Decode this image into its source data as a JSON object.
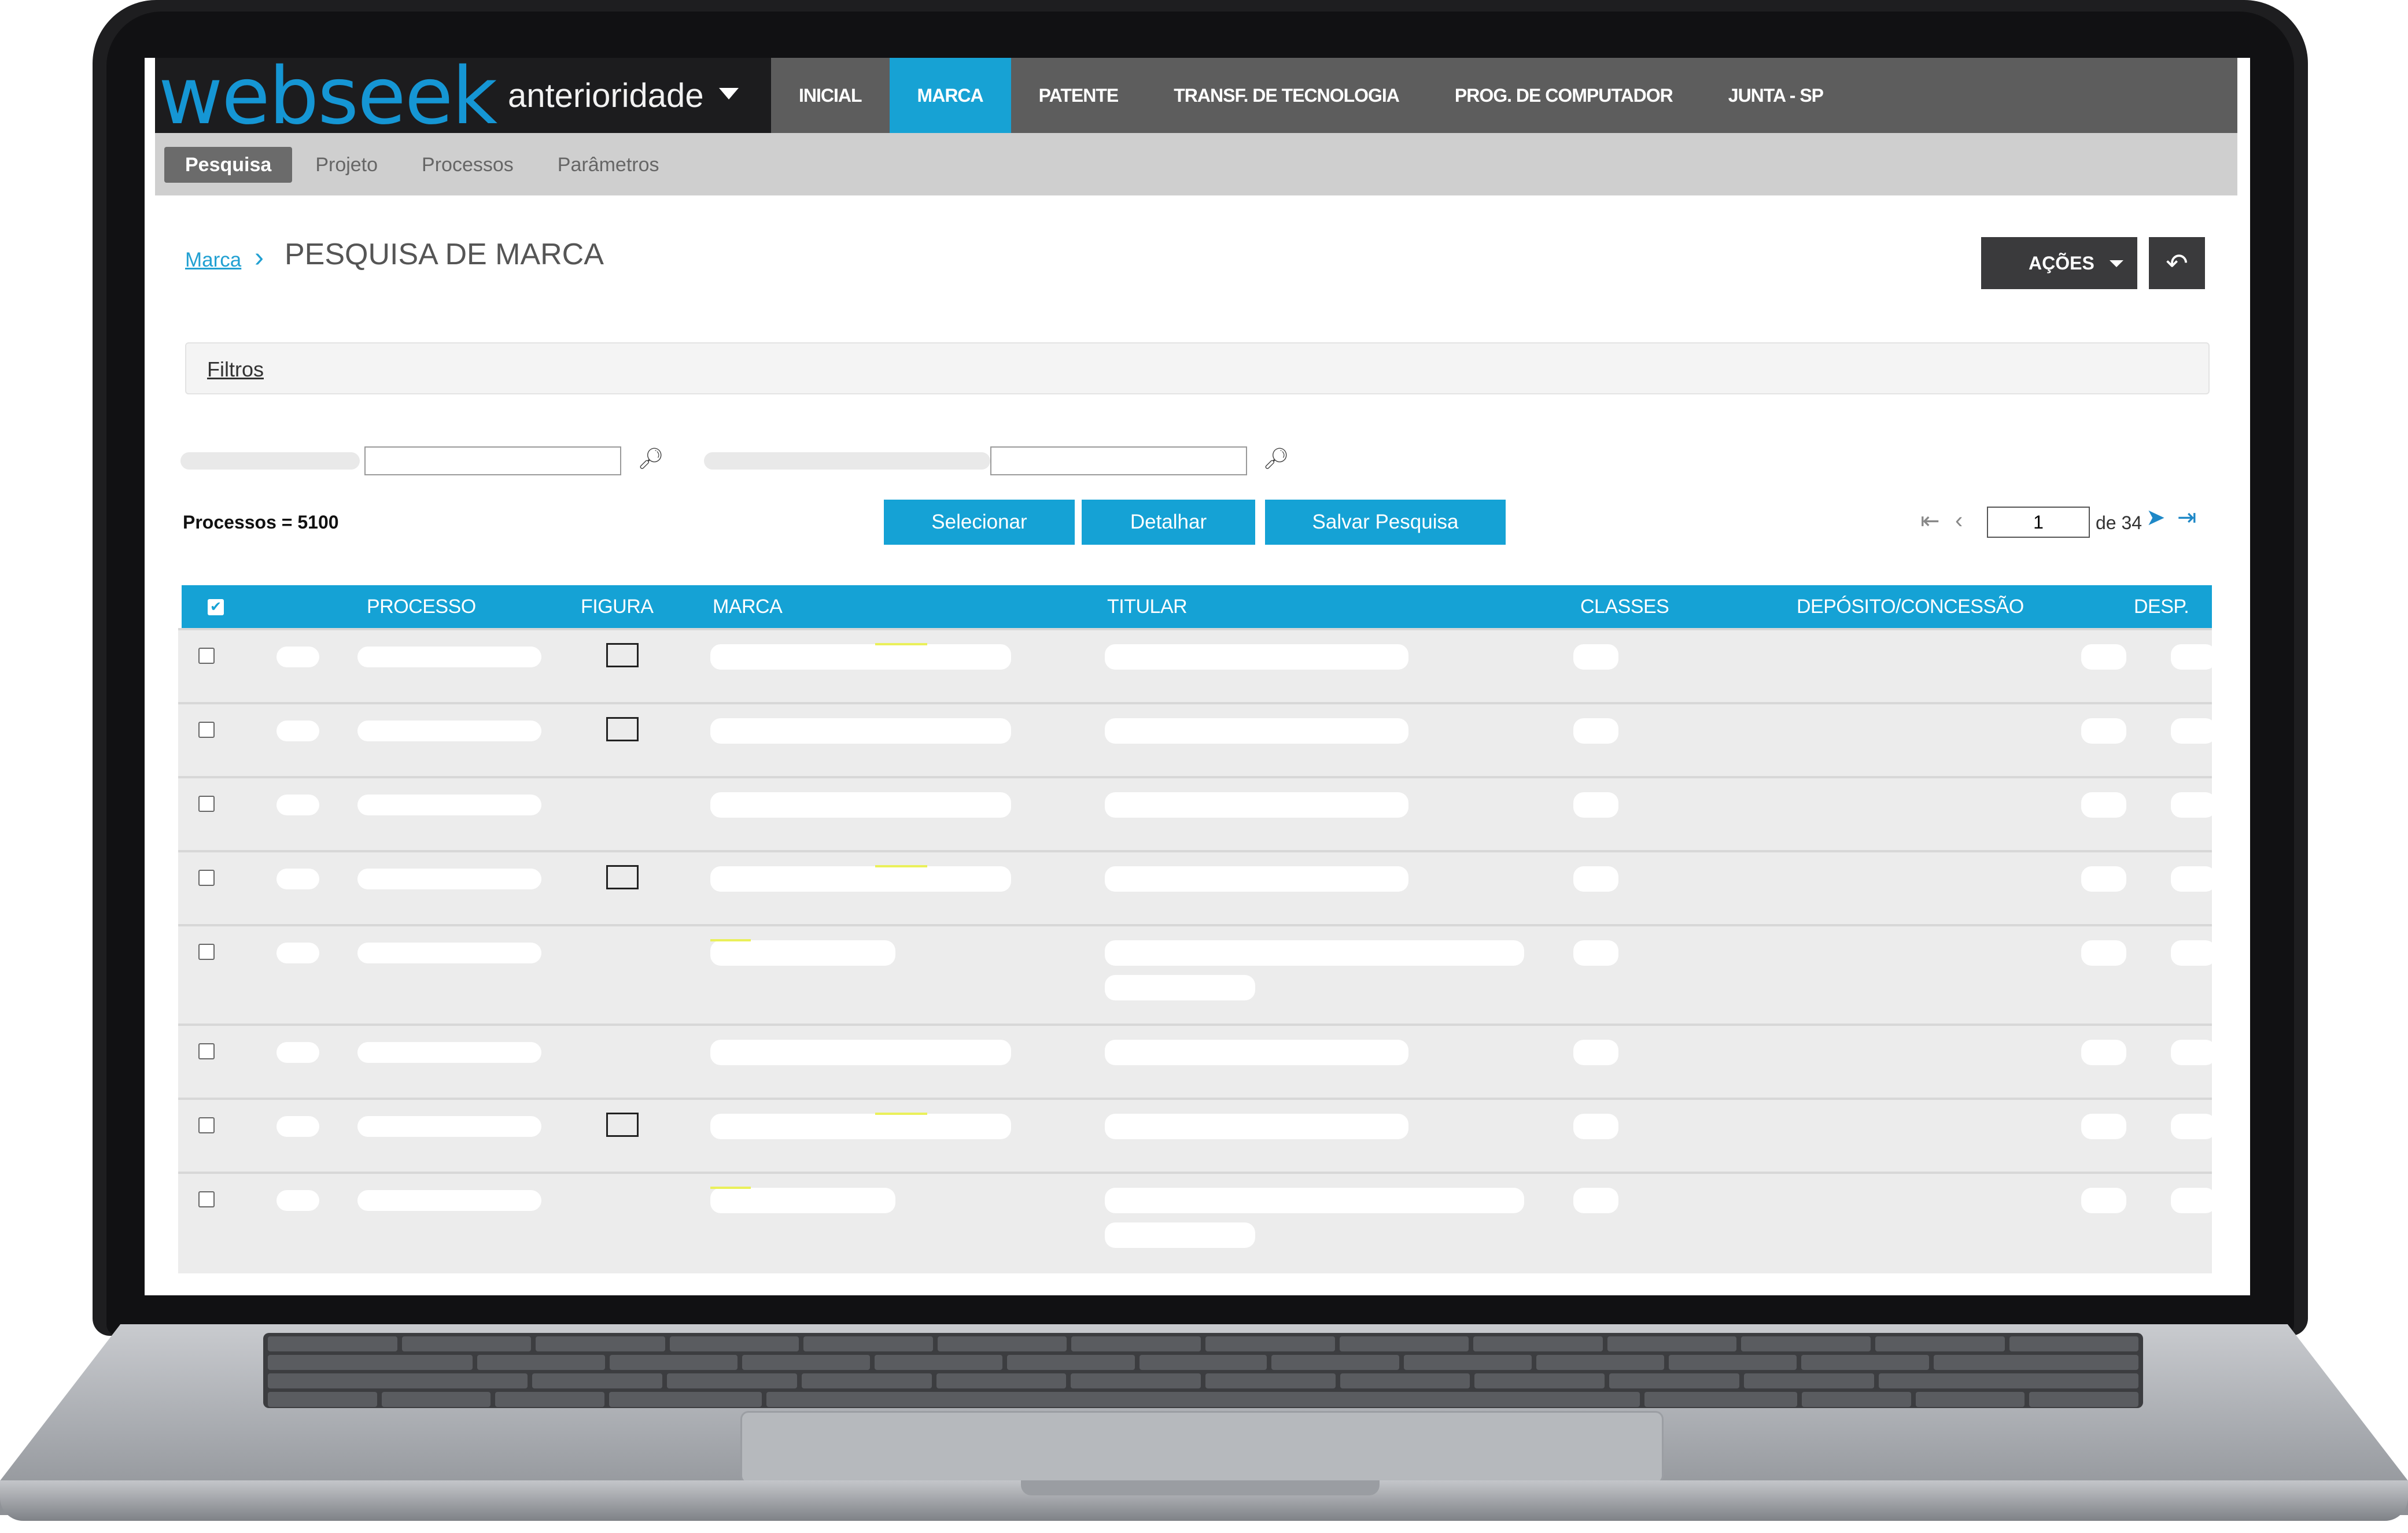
{
  "app": {
    "logo_main": "webseek",
    "logo_sub": "anterioridade",
    "nav": [
      "INICIAL",
      "MARCA",
      "PATENTE",
      "TRANSF. DE TECNOLOGIA",
      "PROG. DE COMPUTADOR",
      "JUNTA - SP"
    ],
    "active_nav": "MARCA",
    "subtabs": [
      "Pesquisa",
      "Projeto",
      "Processos",
      "Parâmetros"
    ],
    "active_subtab": "Pesquisa"
  },
  "breadcrumb": {
    "link": "Marca",
    "separator": "›",
    "title": "PESQUISA DE MARCA"
  },
  "actions": {
    "acoes_label": "AÇÕES",
    "back_icon": "back-arrow-icon"
  },
  "filters": {
    "label": "Filtros"
  },
  "results": {
    "count_label": "Processos = 5100"
  },
  "buttons": {
    "selecionar": "Selecionar",
    "detalhar": "Detalhar",
    "salvar": "Salvar Pesquisa"
  },
  "pager": {
    "current_page": "1",
    "of_label": "de 34"
  },
  "table": {
    "columns": [
      "PROCESSO",
      "FIGURA",
      "MARCA",
      "TITULAR",
      "CLASSES",
      "DEPÓSITO/CONCESSÃO",
      "DESP."
    ],
    "row_count": 8,
    "rows_with_figure": [
      1,
      2,
      4,
      7
    ]
  },
  "colors": {
    "accent": "#15a2d5",
    "dark": "#1c1c1e",
    "nav_bg": "#5d5d5d",
    "row_bg": "#ececec"
  }
}
